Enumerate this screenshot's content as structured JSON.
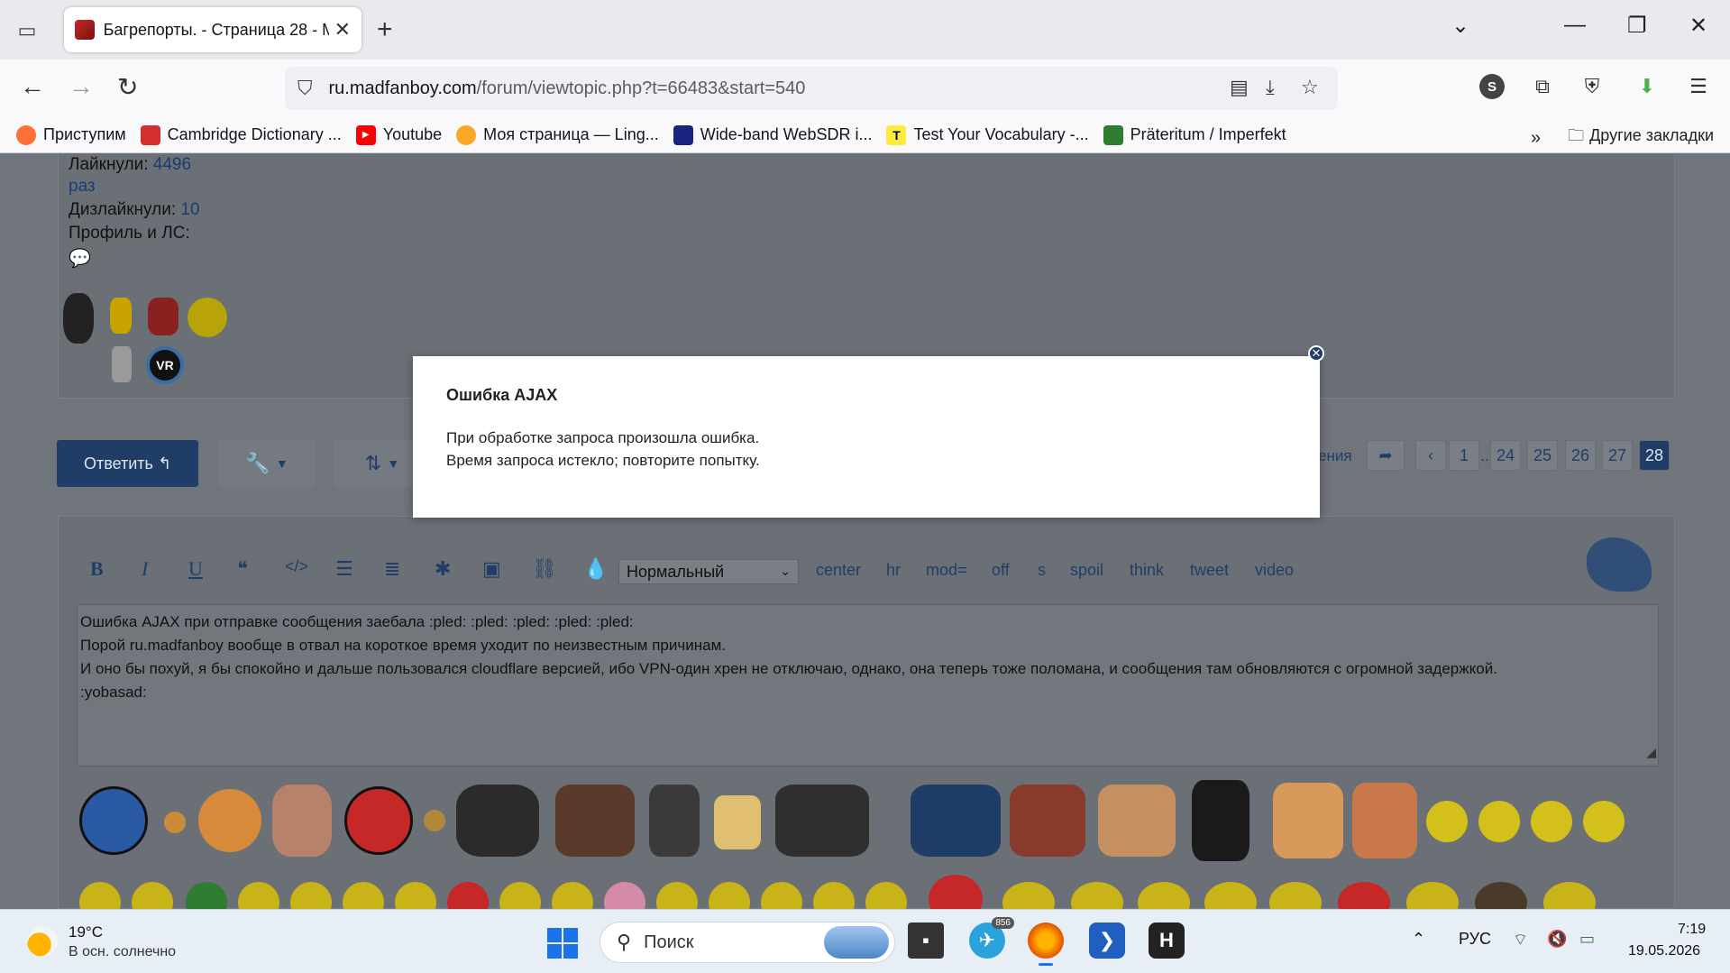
{
  "browser": {
    "tab_title": "Багрепорты. - Страница 28 - M",
    "url_host": "ru.madfanboy.com",
    "url_path": "/forum/viewtopic.php?t=66483&start=540",
    "bookmarks": [
      {
        "label": "Приступим",
        "icon_color": "#ff7139"
      },
      {
        "label": "Cambridge Dictionary ...",
        "icon_color": "#d32f2f"
      },
      {
        "label": "Youtube",
        "icon_color": "#ff0000"
      },
      {
        "label": "Моя страница — Ling...",
        "icon_color": "#f9a825"
      },
      {
        "label": "Wide-band WebSDR i...",
        "icon_color": "#1a237e"
      },
      {
        "label": "Test Your Vocabulary -...",
        "icon_color": "#ffeb3b"
      },
      {
        "label": "Präteritum / Imperfekt",
        "icon_color": "#2e7d32"
      }
    ],
    "other_bookmarks": "Другие закладки",
    "profile_letter": "S"
  },
  "profile": {
    "likes_label": "Лайкнули:",
    "likes_value": "4496",
    "likes_unit": "раз",
    "dislikes_label": "Дизлайкнули:",
    "dislikes_value": "10",
    "pm_label": "Профиль и ЛС:",
    "vr_badge": "VR"
  },
  "actions": {
    "reply_label": "Ответить",
    "pages_label_partial": "ения",
    "pages": [
      "1",
      "...",
      "24",
      "25",
      "26",
      "27",
      "28"
    ],
    "active_page": "28"
  },
  "editor": {
    "size_select": "Нормальный",
    "tags": [
      "center",
      "hr",
      "mod=",
      "off",
      "s",
      "spoil",
      "think",
      "tweet",
      "video"
    ],
    "lines": [
      "Ошибка AJAX при отправке сообщения заебала  :pled:  :pled:  :pled:  :pled:  :pled:",
      "Порой ru.madfanboy вообще в отвал на короткое время уходит по неизвестным причинам.",
      "И оно бы похуй, я бы спокойно и дальше пользовался cloudflare версией, ибо VPN-один хрен не отключаю, однако, она теперь тоже поломана, и сообщения там обновляются с огромной задержкой.",
      ":yobasad:"
    ]
  },
  "modal": {
    "title": "Ошибка AJAX",
    "message_line1": "При обработке запроса произошла ошибка.",
    "message_line2": "Время запроса истекло; повторите попытку."
  },
  "taskbar": {
    "temperature": "19°C",
    "weather": "В осн. солнечно",
    "search_placeholder": "Поиск",
    "telegram_badge": "856",
    "language": "РУС",
    "time": "7:19",
    "date": "19.05.2026"
  },
  "colors": {
    "accent_dark_blue": "#1f3d66",
    "dim_overlay_bg": "#70747b"
  }
}
